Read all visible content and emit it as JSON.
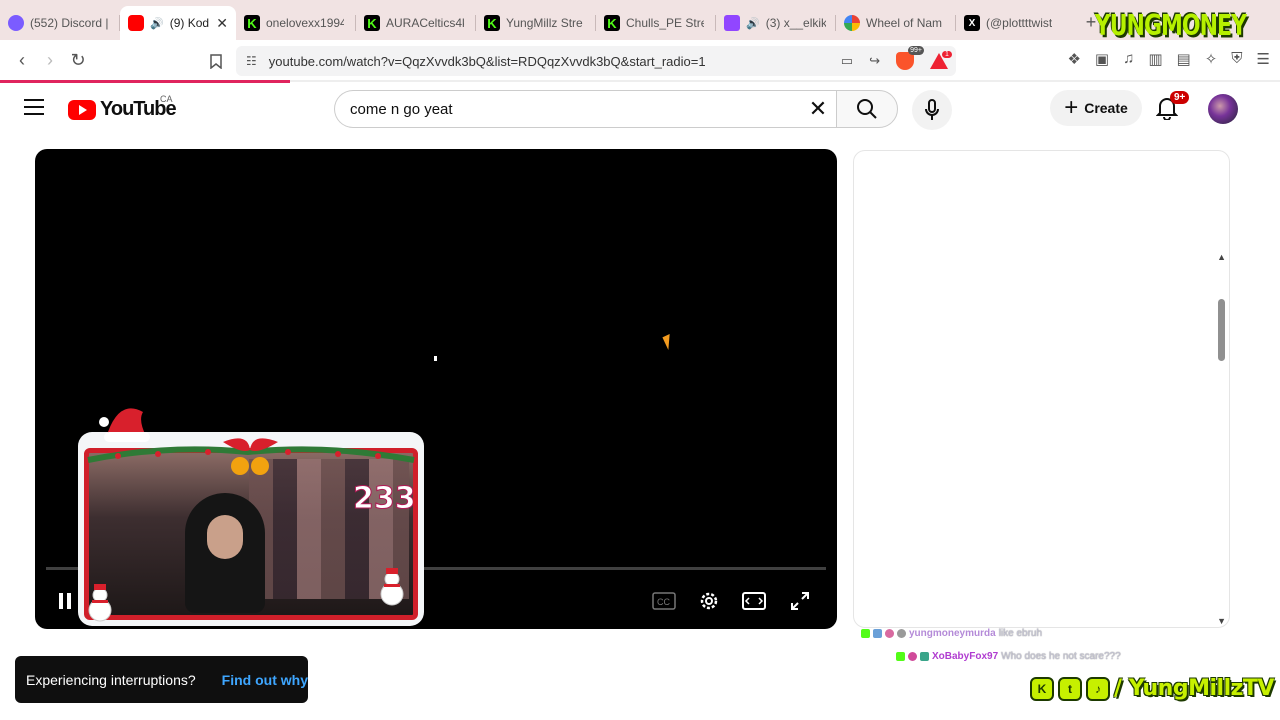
{
  "browser": {
    "tabs": [
      {
        "label": "(552) Discord |",
        "favicon": "discord-icon",
        "badge": "552"
      },
      {
        "label": "(9) Kod",
        "favicon": "youtube-icon",
        "active": true
      },
      {
        "label": "onelovexx1994",
        "favicon": "kick-icon"
      },
      {
        "label": "AURACeltics4k",
        "favicon": "kick-icon"
      },
      {
        "label": "YungMillz Stre",
        "favicon": "kick-icon"
      },
      {
        "label": "Chulls_PE Stre",
        "favicon": "kick-icon"
      },
      {
        "label": "(3) x__elkik",
        "favicon": "twitch-icon"
      },
      {
        "label": "Wheel of Nam",
        "favicon": "wheel-icon"
      },
      {
        "label": "(@plottttwist",
        "favicon": "x-icon"
      }
    ],
    "new_tab": "+",
    "close_glyph": "✕",
    "url": "youtube.com/watch?v=QqzXvvdk3bQ&list=RDQqzXvvdk3bQ&start_radio=1",
    "brave_badge": "99+",
    "rewards_badge": "1"
  },
  "overlay": {
    "brand_title": "YUNGMONEY",
    "viewer_count": "233",
    "social_handle": "/ YungMillzTV",
    "social_icons": [
      "kick-icon",
      "twitter-icon",
      "tiktok-icon"
    ]
  },
  "youtube": {
    "logo_text": "YouTube",
    "country_code": "CA",
    "search_value": "come n go yeat",
    "create_label": "Create",
    "notification_badge": "9+"
  },
  "chat": [
    {
      "user": "yungmoneymurda",
      "message": "like ebruh",
      "user_color": "#b48ad8"
    },
    {
      "user": "XoBabyFox97",
      "message": "Who does he not scare???",
      "user_color": "#b03cd0"
    }
  ],
  "toast": {
    "message": "Experiencing interruptions?",
    "link": "Find out why"
  },
  "colors": {
    "youtube_red": "#ff0000",
    "kick_green": "#53fc18",
    "toast_link": "#3ea6ff",
    "overlay_green": "#c6f000"
  }
}
